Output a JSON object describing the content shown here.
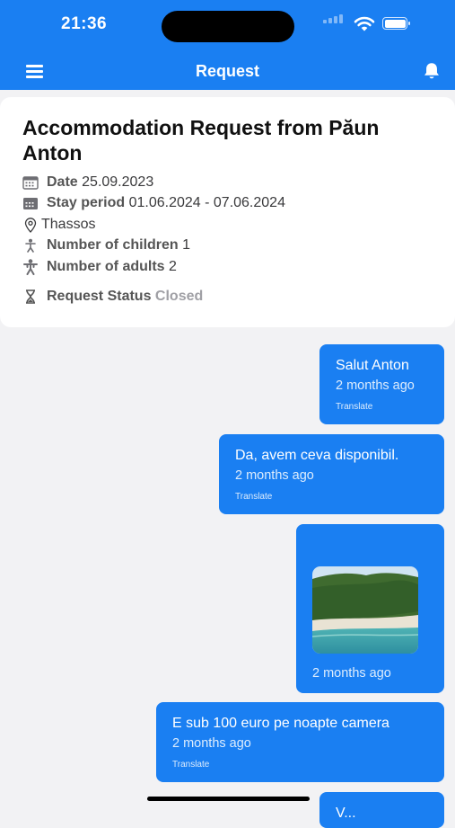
{
  "status_bar": {
    "time": "21:36"
  },
  "header": {
    "title": "Request",
    "menu_icon": "hamburger-menu-icon",
    "bell_icon": "bell-icon",
    "color": "#1a7ff2"
  },
  "request": {
    "title": "Accommodation Request from Păun Anton",
    "date_label": "Date",
    "date_value": "25.09.2023",
    "stay_label": "Stay period",
    "stay_value": "01.06.2024 - 07.06.2024",
    "location": "Thassos",
    "children_label": "Number of children",
    "children_value": "1",
    "adults_label": "Number of adults",
    "adults_value": "2",
    "status_label": "Request Status",
    "status_value": "Closed"
  },
  "messages": [
    {
      "text": "Salut Anton",
      "time": "2 months ago",
      "translate": "Translate"
    },
    {
      "text": "Da, avem ceva disponibil.",
      "time": "2 months ago",
      "translate": "Translate"
    },
    {
      "image": "beach-photo",
      "time": "2 months ago"
    },
    {
      "text": "E sub 100 euro pe noapte camera",
      "time": "2 months ago",
      "translate": "Translate"
    },
    {
      "text": "V..."
    }
  ]
}
